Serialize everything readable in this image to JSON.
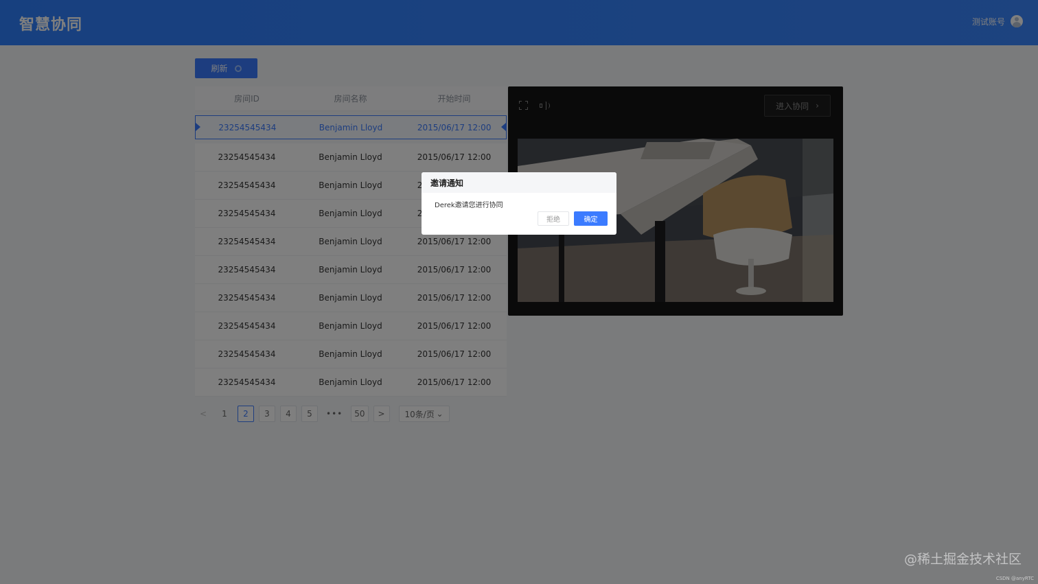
{
  "header": {
    "logo": "智慧协同",
    "account": "测试账号"
  },
  "toolbar": {
    "refresh_label": "刷新"
  },
  "table": {
    "columns": [
      "房间ID",
      "房间名称",
      "开始时间"
    ],
    "rows": [
      {
        "id": "23254545434",
        "name": "Benjamin Lloyd",
        "time": "2015/06/17 12:00",
        "selected": true
      },
      {
        "id": "23254545434",
        "name": "Benjamin Lloyd",
        "time": "2015/06/17 12:00"
      },
      {
        "id": "23254545434",
        "name": "Benjamin Lloyd",
        "time": "2015/06/17 12:00"
      },
      {
        "id": "23254545434",
        "name": "Benjamin Lloyd",
        "time": "2015/06/17 12:00"
      },
      {
        "id": "23254545434",
        "name": "Benjamin Lloyd",
        "time": "2015/06/17 12:00"
      },
      {
        "id": "23254545434",
        "name": "Benjamin Lloyd",
        "time": "2015/06/17 12:00"
      },
      {
        "id": "23254545434",
        "name": "Benjamin Lloyd",
        "time": "2015/06/17 12:00"
      },
      {
        "id": "23254545434",
        "name": "Benjamin Lloyd",
        "time": "2015/06/17 12:00"
      },
      {
        "id": "23254545434",
        "name": "Benjamin Lloyd",
        "time": "2015/06/17 12:00"
      },
      {
        "id": "23254545434",
        "name": "Benjamin Lloyd",
        "time": "2015/06/17 12:00"
      }
    ]
  },
  "pagination": {
    "prev": "<",
    "pages": [
      "1",
      "2",
      "3",
      "4",
      "5"
    ],
    "current": "2",
    "ellipsis": "•••",
    "last": "50",
    "next": ">",
    "page_size": "10条/页",
    "page_size_caret": "⌄"
  },
  "video_panel": {
    "fullscreen_icon": "fullscreen-icon",
    "volume_icon": "volume-icon",
    "enter_label": "进入协同",
    "enter_chevron": "›"
  },
  "modal": {
    "title": "邀请通知",
    "message": "Derek邀请您进行协同",
    "reject_label": "拒绝",
    "confirm_label": "确定"
  },
  "watermark": "@稀土掘金技术社区",
  "credit": "CSDN @anyRTC",
  "colors": {
    "primary": "#3b7bff",
    "header": "#2f80ff",
    "overlay": "rgba(0,0,0,0.50)",
    "video_bg": "#141414"
  }
}
